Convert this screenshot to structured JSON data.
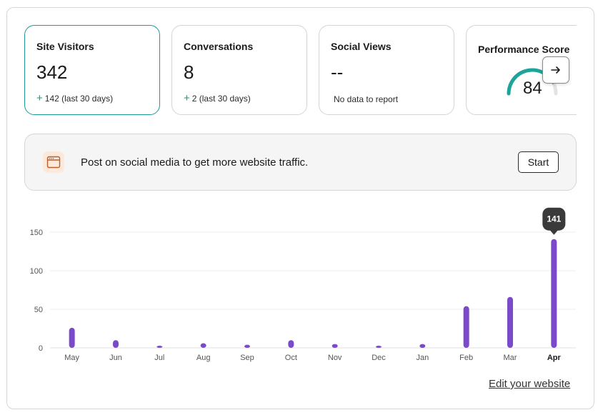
{
  "cards": [
    {
      "title": "Site Visitors",
      "value": "342",
      "delta_sign": "+",
      "delta": "142 (last 30 days)"
    },
    {
      "title": "Conversations",
      "value": "8",
      "delta_sign": "+",
      "delta": "2 (last 30 days)"
    },
    {
      "title": "Social Views",
      "value": "--",
      "note": "No data to report"
    },
    {
      "title": "Performance Score",
      "value": "84",
      "score": 84,
      "score_max": 100
    }
  ],
  "next_icon": "arrow-right-icon",
  "promo": {
    "icon": "browser-window-icon",
    "text": "Post on social media to get more website traffic.",
    "button": "Start"
  },
  "colors": {
    "accent": "#1b9a9a",
    "bar": "#7b4acb",
    "gauge": "#1ba39c",
    "tooltip": "#3a3a3a",
    "positive": "#1b9a6e"
  },
  "chart_data": {
    "type": "bar",
    "categories": [
      "May",
      "Jun",
      "Jul",
      "Aug",
      "Sep",
      "Oct",
      "Nov",
      "Dec",
      "Jan",
      "Feb",
      "Mar",
      "Apr"
    ],
    "values": [
      26,
      10,
      2,
      6,
      4,
      10,
      5,
      1,
      5,
      54,
      66,
      141
    ],
    "yticks": [
      0,
      50,
      100,
      150
    ],
    "ylim": [
      0,
      150
    ],
    "highlighted_category": "Apr",
    "tooltip": "141",
    "grid": true
  },
  "edit_link": "Edit your website"
}
